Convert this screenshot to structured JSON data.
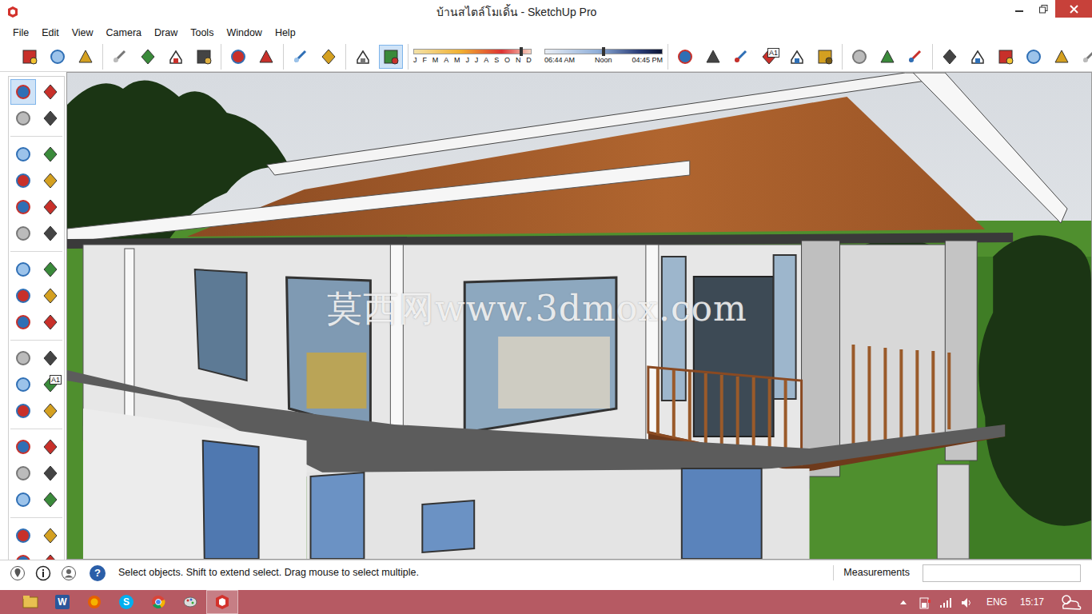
{
  "window": {
    "title": "บ้านสไตล์โมเดิ้น - SketchUp Pro"
  },
  "menu": [
    "File",
    "Edit",
    "View",
    "Camera",
    "Draw",
    "Tools",
    "Window",
    "Help"
  ],
  "top_tools": [
    [
      {
        "selected": false
      },
      {
        "selected": false
      },
      {
        "selected": false
      }
    ],
    [
      {
        "selected": false
      },
      {
        "selected": false
      },
      {
        "selected": false
      },
      {
        "selected": false
      }
    ],
    [
      {
        "selected": false
      },
      {
        "selected": false
      }
    ],
    [
      {
        "selected": false
      },
      {
        "selected": false
      }
    ],
    [
      {
        "selected": false
      },
      {
        "selected": true
      }
    ],
    [
      {
        "selected": false
      },
      {
        "selected": false
      },
      {
        "selected": false
      },
      {
        "selected": false,
        "label": "A1"
      },
      {
        "selected": false
      },
      {
        "selected": false
      }
    ],
    [
      {
        "selected": false
      },
      {
        "selected": false
      },
      {
        "selected": false
      }
    ],
    [
      {
        "selected": false
      },
      {
        "selected": false
      },
      {
        "selected": false
      },
      {
        "selected": false
      },
      {
        "selected": false
      },
      {
        "selected": false
      }
    ]
  ],
  "shadow": {
    "months": [
      "J",
      "F",
      "M",
      "A",
      "M",
      "J",
      "J",
      "A",
      "S",
      "O",
      "N",
      "D"
    ],
    "date_level": 0.92,
    "times": [
      "06:44 AM",
      "Noon",
      "04:45 PM"
    ],
    "time_level": 0.5
  },
  "left_tools": [
    [
      {
        "selected": true
      },
      {
        "selected": false
      },
      {
        "selected": false
      },
      {
        "selected": false
      }
    ],
    [
      {
        "selected": false
      },
      {
        "selected": false
      },
      {
        "selected": false
      },
      {
        "selected": false
      },
      {
        "selected": false
      },
      {
        "selected": false
      },
      {
        "selected": false
      },
      {
        "selected": false
      }
    ],
    [
      {
        "selected": false
      },
      {
        "selected": false
      },
      {
        "selected": false
      },
      {
        "selected": false
      },
      {
        "selected": false
      },
      {
        "selected": false
      }
    ],
    [
      {
        "selected": false
      },
      {
        "selected": false
      },
      {
        "selected": false
      },
      {
        "selected": false,
        "label": "A1"
      },
      {
        "selected": false
      },
      {
        "selected": false
      }
    ],
    [
      {
        "selected": false
      },
      {
        "selected": false
      },
      {
        "selected": false
      },
      {
        "selected": false
      },
      {
        "selected": false
      },
      {
        "selected": false
      }
    ],
    [
      {
        "selected": false
      },
      {
        "selected": false
      },
      {
        "selected": false
      },
      {
        "selected": false
      }
    ]
  ],
  "viewport": {
    "watermark": "莫西网www.3dmox.com"
  },
  "status": {
    "help": "?",
    "hint": "Select objects. Shift to extend select. Drag mouse to select multiple.",
    "measurements_label": "Measurements",
    "measurements_value": ""
  },
  "taskbar": {
    "apps": [
      {
        "label": "",
        "selected": false
      },
      {
        "label": "W",
        "selected": false
      },
      {
        "label": "",
        "selected": false
      },
      {
        "label": "S",
        "selected": false
      },
      {
        "label": "",
        "selected": false
      },
      {
        "label": "",
        "selected": false
      },
      {
        "label": "",
        "selected": true
      }
    ],
    "lang": "ENG",
    "time": "15:17"
  }
}
